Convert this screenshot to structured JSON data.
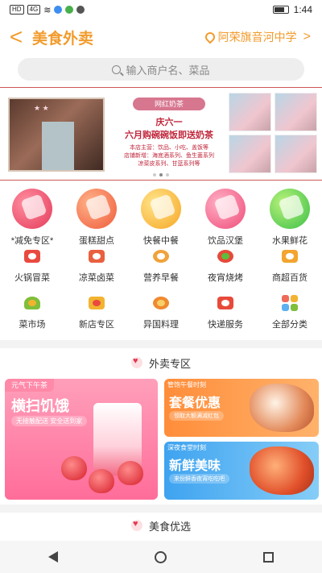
{
  "status_bar": {
    "time": "1:44",
    "left_chips": [
      "HD",
      "4G"
    ]
  },
  "header": {
    "back_label": "<",
    "title": "美食外卖",
    "location": "阿荣旗音河中学",
    "location_chevron": ">"
  },
  "search": {
    "placeholder": "输入商户名、菜品"
  },
  "banner": {
    "ribbon": "网红奶茶",
    "line1": "庆六一",
    "line2": "六月购碗碗饭即送奶茶",
    "line3": "本店主营：饮品、小吃、盖饭等",
    "line4": "店铺新增：海底酒系列、鱼生菌系列",
    "line5": "凉菜皮系列、甘蓝系列等"
  },
  "big_categories": [
    {
      "label": "*减免专区*",
      "color": "red"
    },
    {
      "label": "蛋糕甜点",
      "color": "orange"
    },
    {
      "label": "快餐中餐",
      "color": "yellow"
    },
    {
      "label": "饮品汉堡",
      "color": "pink"
    },
    {
      "label": "水果鲜花",
      "color": "green"
    }
  ],
  "small_categories": [
    {
      "label": "火锅冒菜",
      "color": "#e94a3f"
    },
    {
      "label": "凉菜卤菜",
      "color": "#e9603f"
    },
    {
      "label": "营养早餐",
      "color": "#f0a33a"
    },
    {
      "label": "夜宵烧烤",
      "color": "#e64a3a"
    },
    {
      "label": "商超百货",
      "color": "#f2a52f"
    },
    {
      "label": "菜市场",
      "color": "#7fbf3b"
    },
    {
      "label": "新店专区",
      "color": "#f2b430"
    },
    {
      "label": "异国料理",
      "color": "#f08a2f"
    },
    {
      "label": "快递服务",
      "color": "#e84a3a"
    },
    {
      "label": "全部分类",
      "color": "#f06a5a"
    }
  ],
  "section1": {
    "title": "外卖专区"
  },
  "promo_left": {
    "tag": "元气下午茶",
    "title": "横扫饥饿",
    "sub": "无接触配送 安全送到家"
  },
  "promo_right_top": {
    "tag": "管饱午餐时刻",
    "title": "套餐优惠",
    "sub": "领取大额满减红包"
  },
  "promo_right_bottom": {
    "tag": "深夜食堂时刻",
    "title": "新鲜美味",
    "sub": "来份鲜香夜宵吃吃吧"
  },
  "section2": {
    "title": "美食优选"
  }
}
